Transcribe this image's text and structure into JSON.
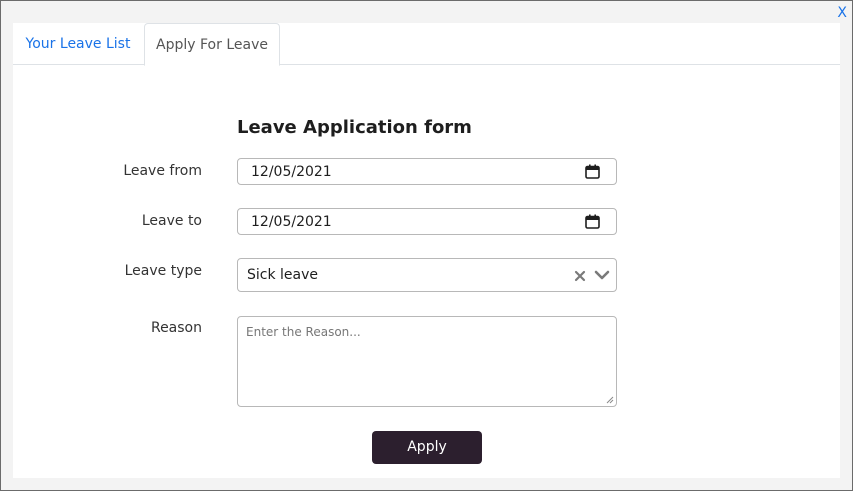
{
  "dialog": {
    "close_label": "X"
  },
  "tabs": [
    {
      "label": "Your Leave List",
      "active": false
    },
    {
      "label": "Apply For Leave",
      "active": true
    }
  ],
  "form": {
    "title": "Leave Application form",
    "leave_from": {
      "label": "Leave from",
      "value": "12/05/2021"
    },
    "leave_to": {
      "label": "Leave to",
      "value": "12/05/2021"
    },
    "leave_type": {
      "label": "Leave type",
      "value": "Sick leave"
    },
    "reason": {
      "label": "Reason",
      "placeholder": "Enter the Reason..."
    },
    "submit_label": "Apply"
  },
  "icons": {
    "date_picker": "calendar-icon",
    "clear": "close-icon",
    "dropdown": "chevron-down-icon",
    "resize": "resize-handle-icon"
  },
  "colors": {
    "accent": "#1a73e8",
    "button_bg": "#2c1f2e",
    "frame_bg": "#f3f3f3"
  }
}
